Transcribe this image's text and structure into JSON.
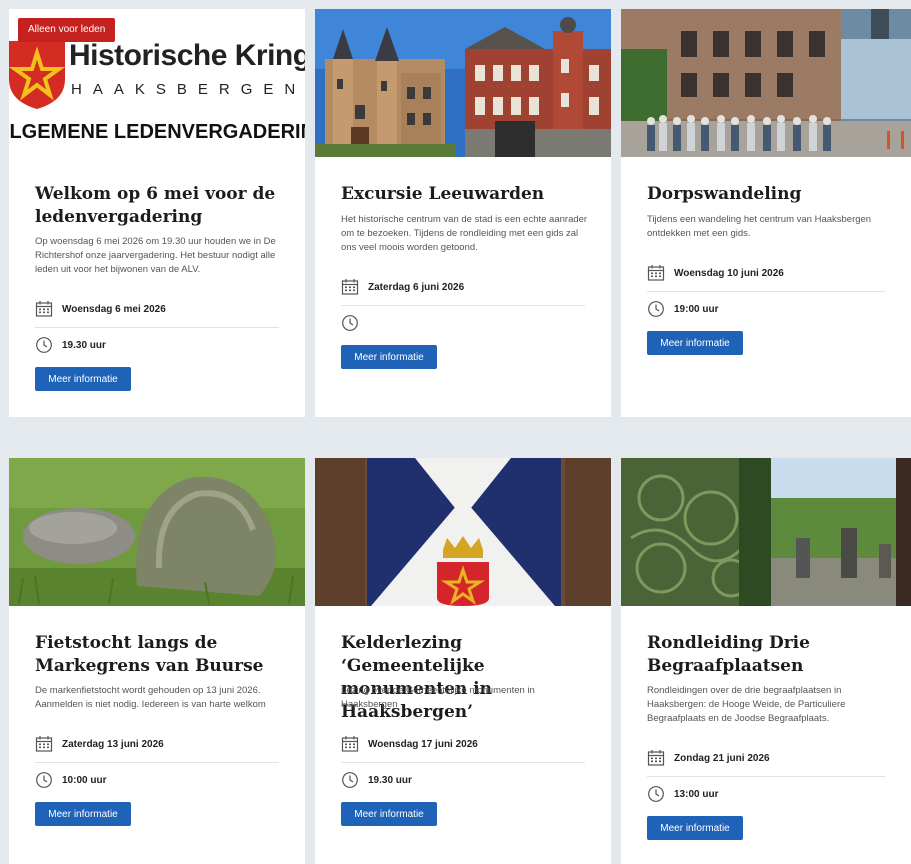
{
  "badge": "Alleen voor leden",
  "logo": {
    "name": "Historische Kring",
    "place": "HAAKSBERGEN",
    "banner": "ALGEMENE LEDENVERGADERING"
  },
  "button_label": "Meer informatie",
  "colors": {
    "button": "#1f63b8",
    "badge": "#c5211f",
    "page_bg": "#e3e9ec"
  },
  "cards": [
    {
      "title": "Welkom op 6 mei voor de ledenvergadering",
      "description": "Op woensdag 6 mei 2026 om 19.30 uur houden we in De Richtershof onze jaarvergadering. Het bestuur nodigt alle leden uit voor het bijwonen van de ALV.",
      "date": "Woensdag 6 mei 2026",
      "time": "19.30 uur",
      "image": "logo-banner"
    },
    {
      "title": "Excursie Leeuwarden",
      "description": "Het historische centrum van de stad is een echte aanrader om te bezoeken. Tijdens de rondleiding met een gids zal ons veel moois worden getoond.",
      "date": "Zaterdag 6 juni 2026",
      "time": "",
      "image": "historic-buildings"
    },
    {
      "title": "Dorpswandeling",
      "description": "Tijdens een wandeling het centrum van Haaksbergen ontdekken met een gids.",
      "date": "Woensdag 10 juni 2026",
      "time": "19:00 uur",
      "image": "walking-group"
    },
    {
      "title": "Fietstocht langs de Markegrens van Buurse",
      "description": "De markenfietstocht wordt gehouden op 13 juni 2026. Aanmelden is niet nodig. Iedereen is van harte welkom",
      "date": "Zaterdag 13 juni 2026",
      "time": "10:00 uur",
      "image": "boundary-stones"
    },
    {
      "title": "Kelderlezing ‘Gemeentelijke monumenten in Haaksbergen’",
      "description": "Lezing over de Gemeentelijke monumenten in Haaksbergen",
      "date": "Woensdag 17 juni 2026",
      "time": "19.30 uur",
      "image": "coat-of-arms"
    },
    {
      "title": "Rondleiding Drie Begraafplaatsen",
      "description": "Rondleidingen over de drie begraafplaatsen in Haaksbergen: de Hooge Weide, de Particuliere Begraafplaats en de Joodse Begraafplaats.",
      "date": "Zondag 21 juni 2026",
      "time": "13:00 uur",
      "image": "cemetery-gate"
    }
  ]
}
